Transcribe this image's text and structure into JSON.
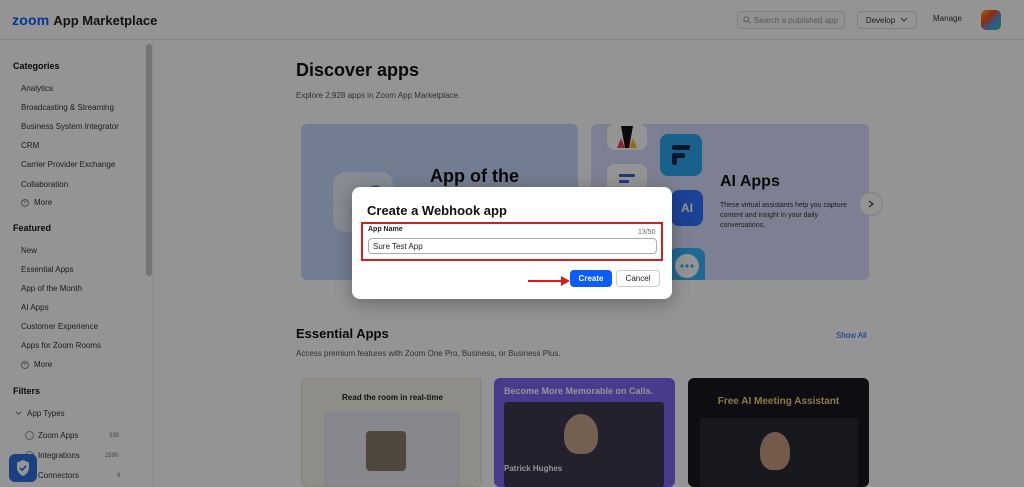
{
  "header": {
    "logo_brand": "zoom",
    "logo_product": "App Marketplace",
    "search_placeholder": "Search a published app",
    "develop_label": "Develop",
    "manage_label": "Manage"
  },
  "sidebar": {
    "categories_title": "Categories",
    "categories": [
      "Analytics",
      "Broadcasting & Streaming",
      "Business System Integrator",
      "CRM",
      "Carrier Provider Exchange",
      "Collaboration"
    ],
    "categories_more": "More",
    "featured_title": "Featured",
    "featured": [
      "New",
      "Essential Apps",
      "App of the Month",
      "AI Apps",
      "Customer Experience",
      "Apps for Zoom Rooms"
    ],
    "featured_more": "More",
    "filters_title": "Filters",
    "app_types_label": "App Types",
    "app_types": [
      {
        "label": "Zoom Apps",
        "count": "330"
      },
      {
        "label": "Integrations",
        "count": "2590"
      },
      {
        "label": "Connectors",
        "count": "8"
      }
    ]
  },
  "main": {
    "title": "Discover apps",
    "subtitle": "Explore 2,928 apps in Zoom App Marketplace.",
    "hero1_title": "App of the",
    "hero2_title": "AI Apps",
    "hero2_desc": "These virtual assistants help you capture content and insight in your daily conversations.",
    "hero2_ai_badge": "AI",
    "essential_title": "Essential Apps",
    "essential_sub": "Access premium features with Zoom One Pro, Business, or Business Plus.",
    "show_all": "Show All",
    "card1_headline": "Read the room in real-time",
    "card2_headline": "Become More Memorable on Calls.",
    "card2_name": "Patrick Hughes",
    "card3_headline": "Free AI Meeting Assistant"
  },
  "modal": {
    "title": "Create a Webhook app",
    "field_label": "App Name",
    "field_count": "13/50",
    "field_value": "Sure Test App",
    "create_label": "Create",
    "cancel_label": "Cancel"
  },
  "colors": {
    "accent": "#0b5cff",
    "highlight": "#d62020"
  }
}
